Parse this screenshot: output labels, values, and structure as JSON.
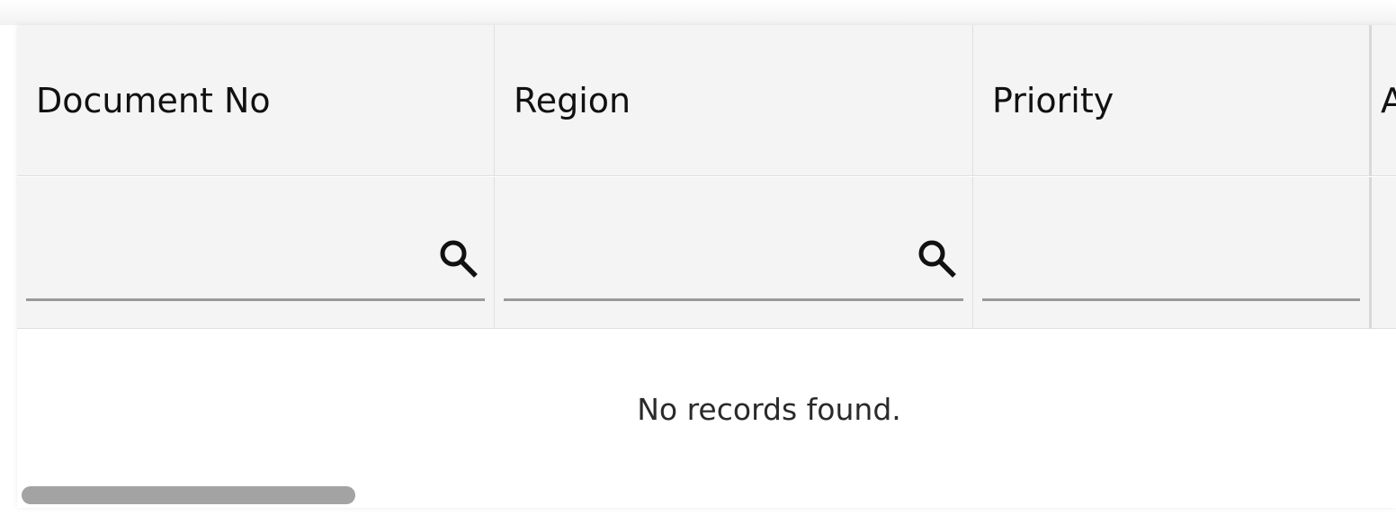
{
  "columns": [
    {
      "label": "Document No",
      "filter_value": "",
      "has_search": true
    },
    {
      "label": "Region",
      "filter_value": "",
      "has_search": true
    },
    {
      "label": "Priority",
      "filter_value": "",
      "has_search": false
    },
    {
      "label": "A",
      "filter_value": "",
      "has_search": false
    }
  ],
  "empty_message": "No records found.",
  "icons": {
    "search": "search-icon"
  }
}
